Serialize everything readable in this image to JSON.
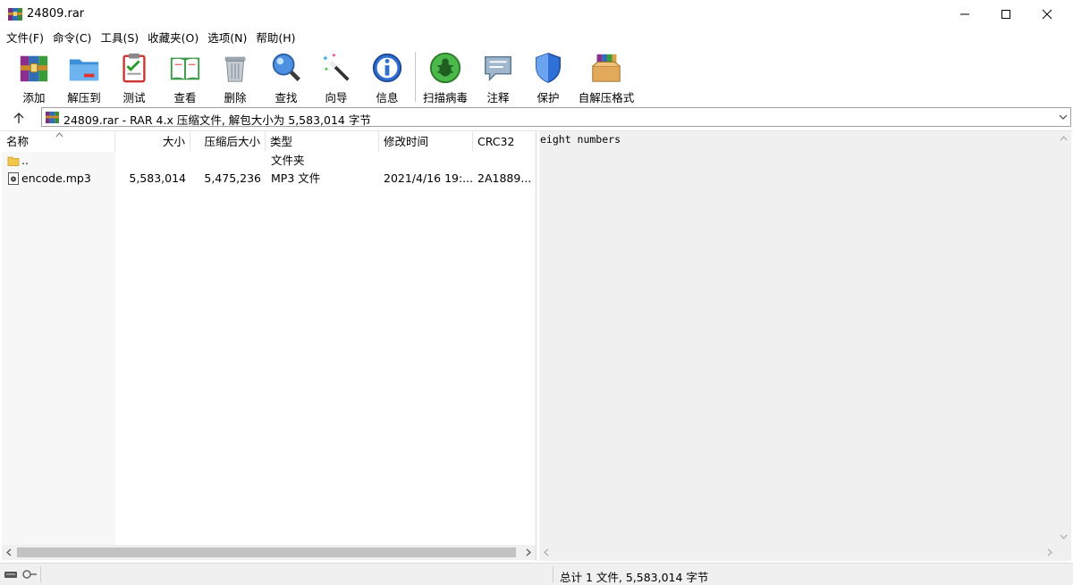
{
  "window": {
    "title": "24809.rar",
    "controls": {
      "minimize": "minimize",
      "maximize": "maximize",
      "close": "close"
    }
  },
  "menu": [
    "文件(F)",
    "命令(C)",
    "工具(S)",
    "收藏夹(O)",
    "选项(N)",
    "帮助(H)"
  ],
  "toolbar": {
    "add": "添加",
    "extract": "解压到",
    "test": "测试",
    "view": "查看",
    "delete": "删除",
    "find": "查找",
    "wizard": "向导",
    "info": "信息",
    "virus_scan": "扫描病毒",
    "comment": "注释",
    "protect": "保护",
    "sfx": "自解压格式"
  },
  "address": {
    "text": "24809.rar - RAR 4.x 压缩文件, 解包大小为 5,583,014 字节"
  },
  "file_list": {
    "columns": {
      "name": "名称",
      "size": "大小",
      "packed": "压缩后大小",
      "type": "类型",
      "modified": "修改时间",
      "crc": "CRC32"
    },
    "rows": [
      {
        "name": "..",
        "size": "",
        "packed": "",
        "type": "文件夹",
        "modified": "",
        "crc": ""
      },
      {
        "name": "encode.mp3",
        "size": "5,583,014",
        "packed": "5,475,236",
        "type": "MP3 文件",
        "modified": "2021/4/16 19:...",
        "crc": "2A1889..."
      }
    ]
  },
  "comment_pane": {
    "text": "eight numbers"
  },
  "status": {
    "summary": "总计 1 文件, 5,583,014 字节"
  }
}
